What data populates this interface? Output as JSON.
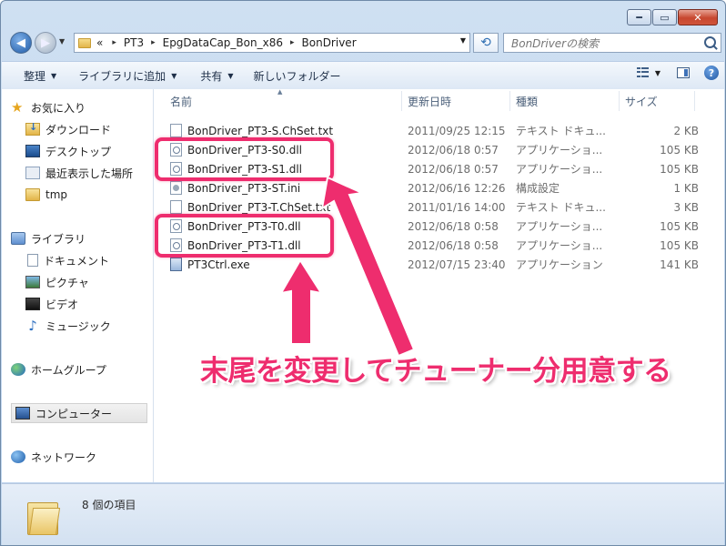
{
  "window": {
    "minimize": "━",
    "maximize": "▭",
    "close": "✕"
  },
  "address": {
    "prefix": "«",
    "crumbs": [
      "PT3",
      "EpgDataCap_Bon_x86",
      "BonDriver"
    ],
    "separator": "▸"
  },
  "search": {
    "placeholder": "BonDriverの検索"
  },
  "toolbar": {
    "organize": "整理",
    "add_to_library": "ライブラリに追加",
    "share": "共有",
    "new_folder": "新しいフォルダー",
    "help": "?"
  },
  "sidebar": {
    "favorites": "お気に入り",
    "downloads": "ダウンロード",
    "desktop": "デスクトップ",
    "recent": "最近表示した場所",
    "tmp": "tmp",
    "libraries": "ライブラリ",
    "documents": "ドキュメント",
    "pictures": "ピクチャ",
    "videos": "ビデオ",
    "music": "ミュージック",
    "homegroup": "ホームグループ",
    "computer": "コンピューター",
    "network": "ネットワーク"
  },
  "columns": {
    "name": "名前",
    "modified": "更新日時",
    "type": "種類",
    "size": "サイズ"
  },
  "files": [
    {
      "name": "BonDriver_PT3-S.ChSet.txt",
      "date": "2011/09/25 12:15",
      "type": "テキスト ドキュ...",
      "size": "2 KB",
      "icon": "text-file-icon"
    },
    {
      "name": "BonDriver_PT3-S0.dll",
      "date": "2012/06/18 0:57",
      "type": "アプリケーショ...",
      "size": "105 KB",
      "icon": "dll-file-icon"
    },
    {
      "name": "BonDriver_PT3-S1.dll",
      "date": "2012/06/18 0:57",
      "type": "アプリケーショ...",
      "size": "105 KB",
      "icon": "dll-file-icon"
    },
    {
      "name": "BonDriver_PT3-ST.ini",
      "date": "2012/06/16 12:26",
      "type": "構成設定",
      "size": "1 KB",
      "icon": "settings-file-icon"
    },
    {
      "name": "BonDriver_PT3-T.ChSet.txt",
      "date": "2011/01/16 14:00",
      "type": "テキスト ドキュ...",
      "size": "3 KB",
      "icon": "text-file-icon"
    },
    {
      "name": "BonDriver_PT3-T0.dll",
      "date": "2012/06/18 0:58",
      "type": "アプリケーショ...",
      "size": "105 KB",
      "icon": "dll-file-icon"
    },
    {
      "name": "BonDriver_PT3-T1.dll",
      "date": "2012/06/18 0:58",
      "type": "アプリケーショ...",
      "size": "105 KB",
      "icon": "dll-file-icon"
    },
    {
      "name": "PT3Ctrl.exe",
      "date": "2012/07/15 23:40",
      "type": "アプリケーション",
      "size": "141 KB",
      "icon": "exe-file-icon"
    }
  ],
  "status": {
    "item_count": "8 個の項目"
  },
  "annotation": {
    "text": "末尾を変更してチューナー分用意する",
    "color": "#ee2d6e"
  }
}
